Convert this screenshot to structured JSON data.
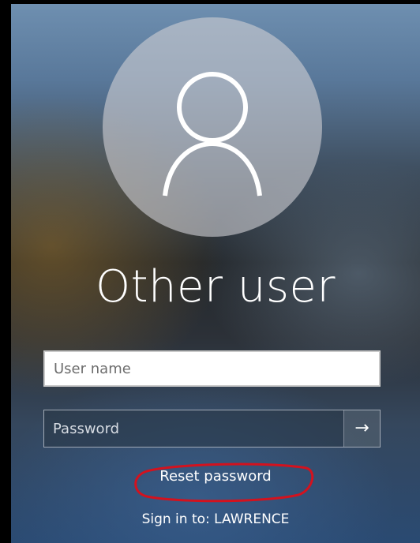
{
  "user": {
    "display_name": "Other user"
  },
  "form": {
    "username_placeholder": "User name",
    "username_value": "",
    "password_placeholder": "Password",
    "password_value": "",
    "submit_icon": "arrow-right-icon",
    "submit_glyph": "→"
  },
  "links": {
    "reset_password": "Reset password",
    "sign_in_to": "Sign in to: LAWRENCE"
  },
  "colors": {
    "highlight_ring": "#d3121e",
    "text": "#ffffff"
  }
}
